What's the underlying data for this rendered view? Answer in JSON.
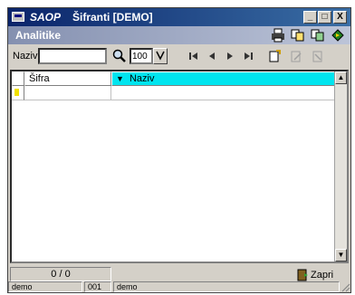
{
  "window": {
    "app_name": "SAOP",
    "title": "Šifranti [DEMO]",
    "controls": [
      "_",
      "□",
      "X"
    ]
  },
  "subheader": {
    "title": "Analitike"
  },
  "toolbar": {
    "search_label": "Naziv",
    "search_value": "",
    "limit_value": "100"
  },
  "table": {
    "columns": [
      "Šifra",
      "Naziv"
    ],
    "sort_indicator": "▼",
    "rows": []
  },
  "footer": {
    "record_count": "0 / 0",
    "close_label": "Zapri"
  },
  "statusbar": {
    "user": "demo",
    "company_code": "001",
    "company_name": "demo"
  },
  "colors": {
    "sort_column_header": "#00e5ef",
    "subheader_bar": "#8490b0",
    "title_bar": "#0a246a"
  }
}
